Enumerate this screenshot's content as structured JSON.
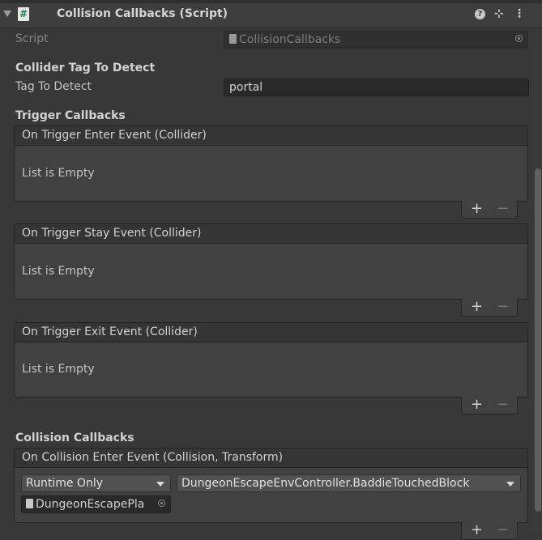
{
  "header": {
    "title": "Collision Callbacks (Script)",
    "script_glyph": "#",
    "help_glyph": "?",
    "preset_glyph": "⊹",
    "more_glyph": "⋮"
  },
  "script_row": {
    "label": "Script",
    "value": "CollisionCallbacks"
  },
  "collider_tag": {
    "section_title": "Collider Tag To Detect",
    "label": "Tag To Detect",
    "value": "portal"
  },
  "trigger_section": "Trigger Callbacks",
  "trigger_events": [
    {
      "title": "On Trigger Enter Event (Collider)",
      "empty_text": "List is Empty"
    },
    {
      "title": "On Trigger Stay Event (Collider)",
      "empty_text": "List is Empty"
    },
    {
      "title": "On Trigger Exit Event (Collider)",
      "empty_text": "List is Empty"
    }
  ],
  "collision_section": "Collision Callbacks",
  "collision_event": {
    "title": "On Collision Enter Event (Collision, Transform)",
    "runtime_option": "Runtime Only",
    "function": "DungeonEscapeEnvController.BaddieTouchedBlock",
    "target_object": "DungeonEscapePla"
  },
  "list_controls": {
    "plus": "+",
    "minus": "−"
  }
}
